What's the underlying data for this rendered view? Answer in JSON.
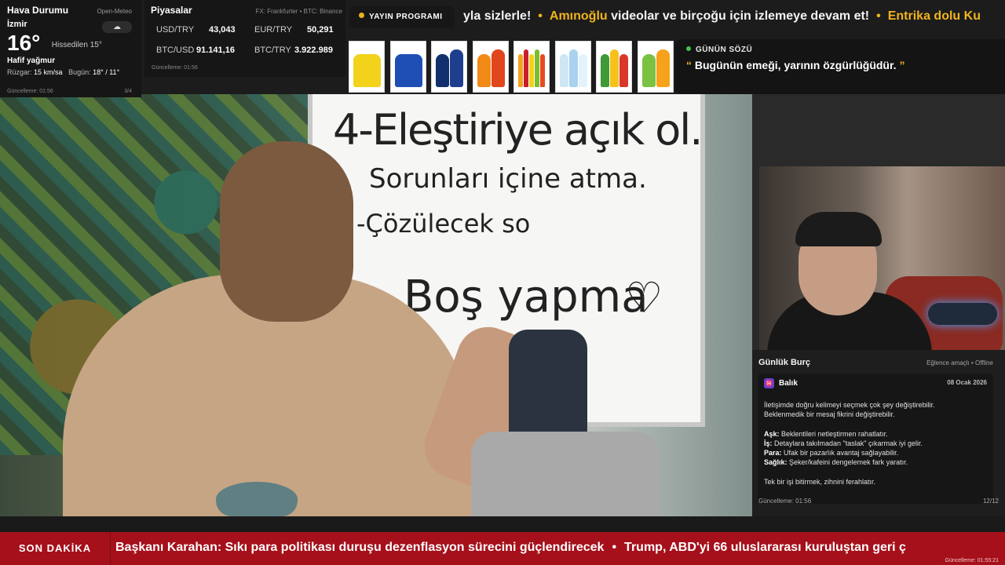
{
  "weather": {
    "title": "Hava Durumu",
    "source": "Open-Meteo",
    "city": "İzmir",
    "temperature": "16°",
    "feels_like": "Hissedilen 15°",
    "condition": "Hafif yağmur",
    "wind_label": "Rüzgar:",
    "wind_value": "15 km/sa",
    "today_label": "Bugün:",
    "today_value": "18° / 11°",
    "updated": "Güncelleme: 01:56",
    "page": "3/4",
    "icon": "cloud-rain-icon"
  },
  "markets": {
    "title": "Piyasalar",
    "source": "FX: Frankfurter • BTC: Binance",
    "rates": [
      {
        "label": "USD/TRY",
        "value": "43,043"
      },
      {
        "label": "EUR/TRY",
        "value": "50,291"
      },
      {
        "label": "BTC/USD",
        "value": "91.141,16"
      },
      {
        "label": "BTC/TRY",
        "value": "3.922.989"
      }
    ],
    "updated": "Güncelleme: 01:56"
  },
  "program": {
    "label": "YAYIN PROGRAMI",
    "accent": "#e6b422"
  },
  "top_ticker": {
    "segments": [
      {
        "text": "yla sizlerle!",
        "highlight": false
      },
      {
        "text": "Amınoğlu",
        "highlight": true
      },
      {
        "text": " videolar ve birçoğu için izlemeye devam et!",
        "highlight": false
      },
      {
        "text": "Entrika dolu Ku",
        "highlight": true
      }
    ],
    "separator": "•"
  },
  "products": [
    {
      "name": "yellow-soda-bottle",
      "colors": [
        "#f3d21c"
      ]
    },
    {
      "name": "blue-can",
      "colors": [
        "#1f4fb5"
      ]
    },
    {
      "name": "dark-blue-bottles",
      "colors": [
        "#13306e",
        "#1f3f8e"
      ]
    },
    {
      "name": "orange-soda-bottles",
      "colors": [
        "#f28a17",
        "#e2461d"
      ]
    },
    {
      "name": "multi-soda-bottles",
      "colors": [
        "#f6a21a",
        "#c8202c",
        "#f2d21a",
        "#7cbd2e",
        "#e84a1f"
      ]
    },
    {
      "name": "water-bottles",
      "colors": [
        "#cfe7f5",
        "#a8d2ef",
        "#e4f2fb"
      ]
    },
    {
      "name": "green-juice-bottles",
      "colors": [
        "#3e9a37",
        "#f5c21b",
        "#d8372a"
      ]
    },
    {
      "name": "mixed-juice-bottles",
      "colors": [
        "#7bc142",
        "#f6a21a"
      ]
    }
  ],
  "quote": {
    "title": "GÜNÜN SÖZÜ",
    "open_mark": "“",
    "text": "Bugünün emeği, yarının özgürlüğüdür.",
    "close_mark": "”"
  },
  "whiteboard": {
    "line1": "4-Eleştiriye açık ol.",
    "line2": "Sorunları içine atma.",
    "line3": "-Çözülecek so",
    "line4": "Boş yapma",
    "heart": "♡"
  },
  "horoscope": {
    "title": "Günlük Burç",
    "note": "Eğlence amaçlı • Offline",
    "sign_glyph": "♓",
    "sign": "Balık",
    "date": "08 Ocak 2026",
    "intro_1": "İletişimde doğru kelimeyi seçmek çok şey değiştirebilir.",
    "intro_2": "Beklenmedik bir mesaj fikrini değiştirebilir.",
    "items": [
      {
        "label": "Aşk:",
        "text": " Beklentileri netleştirmen rahatlatır."
      },
      {
        "label": "İş:",
        "text": " Detaylara takılmadan \"taslak\" çıkarmak iyi gelir."
      },
      {
        "label": "Para:",
        "text": " Ufak bir pazarlık avantaj sağlayabilir."
      },
      {
        "label": "Sağlık:",
        "text": " Şeker/kafeini dengelemek fark yaratır."
      }
    ],
    "outro": "Tek bir işi bitirmek, zihnini ferahlatır.",
    "updated": "Güncelleme: 01:56",
    "page": "12/12"
  },
  "breaking": {
    "label": "SON DAKİKA",
    "items": [
      "Başkanı Karahan: Sıkı para politikası duruşu dezenflasyon sürecini güçlendirecek",
      "Trump, ABD'yi 66 uluslararası kuruluştan geri ç"
    ],
    "separator": "•",
    "updated": "Güncelleme: 01:55:21",
    "color": "#a5101b"
  }
}
